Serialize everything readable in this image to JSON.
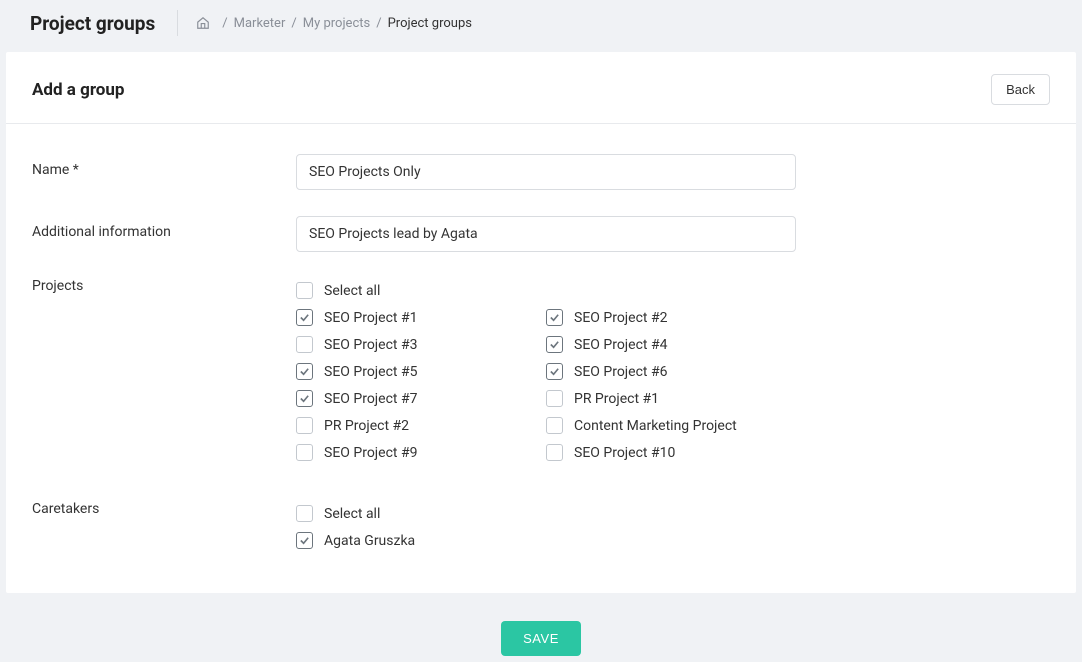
{
  "header": {
    "title": "Project groups",
    "breadcrumb": {
      "item1": "Marketer",
      "item2": "My projects",
      "item3": "Project groups"
    }
  },
  "card": {
    "title": "Add a group",
    "back_label": "Back"
  },
  "form": {
    "name_label": "Name *",
    "name_value": "SEO Projects Only",
    "info_label": "Additional information",
    "info_value": "SEO Projects lead by Agata",
    "projects_label": "Projects",
    "caretakers_label": "Caretakers",
    "select_all_label": "Select all"
  },
  "projects": [
    {
      "label": "SEO Project #1",
      "checked": true
    },
    {
      "label": "SEO Project #2",
      "checked": true
    },
    {
      "label": "SEO Project #3",
      "checked": false
    },
    {
      "label": "SEO Project #4",
      "checked": true
    },
    {
      "label": "SEO Project #5",
      "checked": true
    },
    {
      "label": "SEO Project #6",
      "checked": true
    },
    {
      "label": "SEO Project #7",
      "checked": true
    },
    {
      "label": "PR Project #1",
      "checked": false
    },
    {
      "label": "PR Project #2",
      "checked": false
    },
    {
      "label": "Content Marketing Project",
      "checked": false
    },
    {
      "label": "SEO Project #9",
      "checked": false
    },
    {
      "label": "SEO Project #10",
      "checked": false
    }
  ],
  "caretakers": [
    {
      "label": "Agata Gruszka",
      "checked": true
    }
  ],
  "actions": {
    "save_label": "SAVE"
  }
}
